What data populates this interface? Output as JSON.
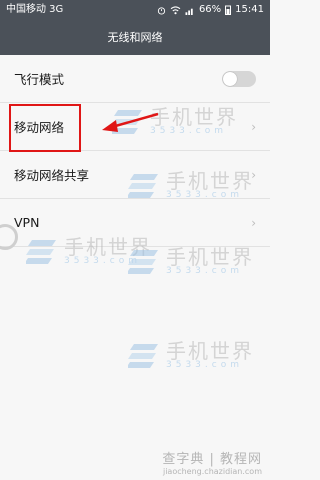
{
  "status_bar": {
    "carrier": "中国移动 3G",
    "battery": "66%",
    "time": "15:41"
  },
  "header": {
    "title": "无线和网络"
  },
  "settings": {
    "items": [
      {
        "label": "飞行模式",
        "control": "toggle",
        "state": "off"
      },
      {
        "label": "移动网络",
        "control": "chevron"
      },
      {
        "label": "移动网络共享",
        "control": "chevron"
      },
      {
        "label": "VPN",
        "control": "chevron"
      }
    ]
  },
  "annotation": {
    "highlight_color": "#e01616"
  },
  "watermark": {
    "text": "手机世界",
    "number": "3533.com",
    "bottom_main": "查字典 | 教程网",
    "bottom_url": "jiaocheng.chazidian.com"
  }
}
